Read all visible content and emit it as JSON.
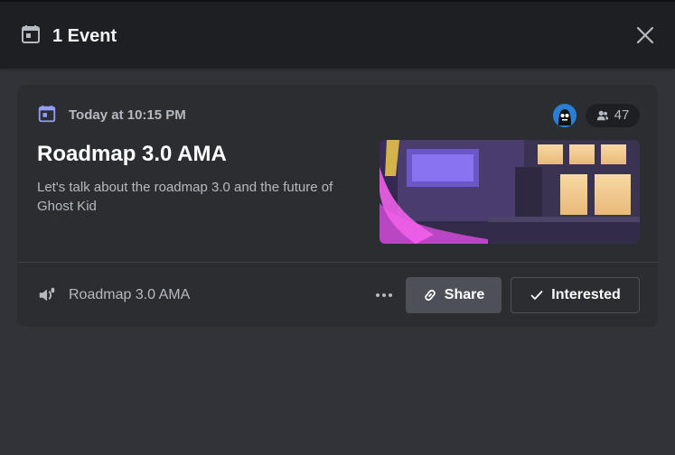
{
  "header": {
    "title": "1 Event",
    "icon": "calendar-icon",
    "close_icon": "close-icon"
  },
  "event": {
    "time": "Today at 10:15 PM",
    "title": "Roadmap 3.0 AMA",
    "description": "Let's talk about the roadmap 3.0 and the future of Ghost Kid",
    "interested_count": "47",
    "channel_name": "Roadmap 3.0 AMA",
    "channel_icon": "stage-channel-icon",
    "cover_image": "neon-city-night-scene"
  },
  "actions": {
    "more_icon": "more-horizontal-icon",
    "share_label": "Share",
    "interested_label": "Interested"
  },
  "colors": {
    "background": "#313338",
    "header": "#1e1f22",
    "card": "#2b2d31",
    "accent": "#949cf7",
    "secondary_button": "#4e5058"
  }
}
